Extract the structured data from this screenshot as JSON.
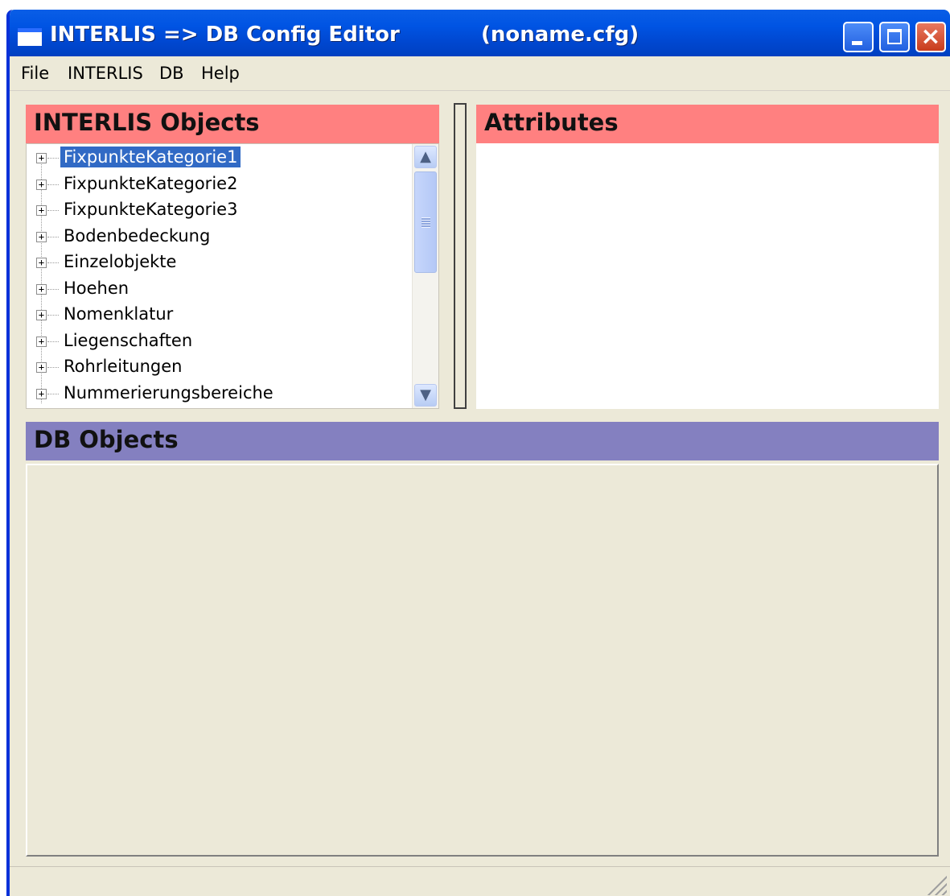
{
  "window": {
    "title": "INTERLIS => DB Config Editor",
    "file": "(noname.cfg)"
  },
  "menu": [
    "File",
    "INTERLIS",
    "DB",
    "Help"
  ],
  "panels": {
    "interlis_objects": "INTERLIS Objects",
    "attributes": "Attributes",
    "db_objects": "DB Objects"
  },
  "tree": {
    "items": [
      "FixpunkteKategorie1",
      "FixpunkteKategorie2",
      "FixpunkteKategorie3",
      "Bodenbedeckung",
      "Einzelobjekte",
      "Hoehen",
      "Nomenklatur",
      "Liegenschaften",
      "Rohrleitungen",
      "Nummerierungsbereiche"
    ],
    "selected_index": 0
  },
  "colors": {
    "interlis_header": "#ff8080",
    "attributes_header": "#ff8080",
    "db_header": "#8480c0",
    "selection": "#316ac5",
    "titlebar": "#0054e3"
  },
  "icons": {
    "expander": "+",
    "scroll_up": "▲",
    "scroll_down": "▼"
  }
}
